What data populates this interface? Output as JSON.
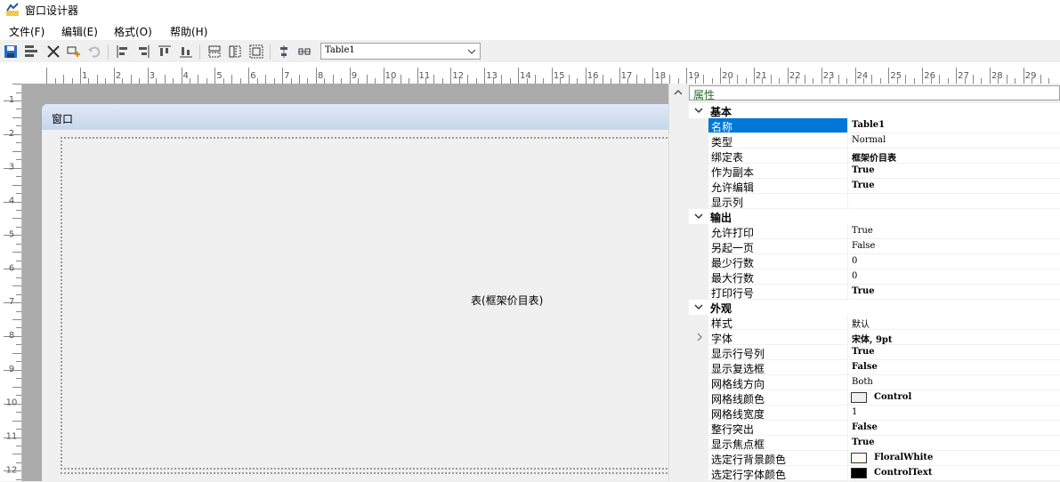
{
  "window": {
    "title": "窗口设计器"
  },
  "menu": [
    "文件(F)",
    "编辑(E)",
    "格式(O)",
    "帮助(H)"
  ],
  "toolbar": {
    "table_select": "Table1",
    "icons": [
      "save-icon",
      "save-all-icon",
      "delete-icon",
      "add-control-icon",
      "undo-icon",
      "align-left-icon",
      "align-right-icon",
      "align-top-icon",
      "align-bottom-icon",
      "same-width-icon",
      "same-height-icon",
      "same-size-icon",
      "center-vertical-icon",
      "center-horizontal-icon"
    ]
  },
  "ruler": {
    "h": [
      "1",
      "2",
      "3",
      "4",
      "5",
      "6",
      "7",
      "8",
      "9",
      "10",
      "11",
      "12",
      "13",
      "14",
      "15",
      "16",
      "17",
      "18",
      "19",
      "20",
      "21",
      "22",
      "23",
      "24",
      "25",
      "26",
      "27",
      "28",
      "29"
    ],
    "v": [
      "1",
      "2",
      "3",
      "4",
      "5",
      "6",
      "7",
      "8",
      "9",
      "10",
      "11",
      "12"
    ]
  },
  "canvas": {
    "form_title": "窗口",
    "table_label": "表(框架价目表)"
  },
  "properties": {
    "panel_title": "属性",
    "rows": [
      {
        "kind": "cat",
        "label": "基本"
      },
      {
        "kind": "prop",
        "name": "名称",
        "value": "Table1",
        "bold": true,
        "selected": true
      },
      {
        "kind": "prop",
        "name": "类型",
        "value": "Normal"
      },
      {
        "kind": "prop",
        "name": "绑定表",
        "value": "框架价目表",
        "bold": true
      },
      {
        "kind": "prop",
        "name": "作为副本",
        "value": "True",
        "bold": true
      },
      {
        "kind": "prop",
        "name": "允许编辑",
        "value": "True",
        "bold": true
      },
      {
        "kind": "prop",
        "name": "显示列",
        "value": ""
      },
      {
        "kind": "cat",
        "label": "输出"
      },
      {
        "kind": "prop",
        "name": "允许打印",
        "value": "True"
      },
      {
        "kind": "prop",
        "name": "另起一页",
        "value": "False"
      },
      {
        "kind": "prop",
        "name": "最少行数",
        "value": "0"
      },
      {
        "kind": "prop",
        "name": "最大行数",
        "value": "0"
      },
      {
        "kind": "prop",
        "name": "打印行号",
        "value": "True",
        "bold": true
      },
      {
        "kind": "cat",
        "label": "外观"
      },
      {
        "kind": "prop",
        "name": "样式",
        "value": "默认"
      },
      {
        "kind": "prop",
        "name": "字体",
        "value": "宋体, 9pt",
        "bold": true,
        "expandable": true
      },
      {
        "kind": "prop",
        "name": "显示行号列",
        "value": "True",
        "bold": true
      },
      {
        "kind": "prop",
        "name": "显示复选框",
        "value": "False",
        "bold": true
      },
      {
        "kind": "prop",
        "name": "网格线方向",
        "value": "Both"
      },
      {
        "kind": "prop",
        "name": "网格线颜色",
        "value": "Control",
        "bold": true,
        "swatch": "#f0f0f0"
      },
      {
        "kind": "prop",
        "name": "网格线宽度",
        "value": "1"
      },
      {
        "kind": "prop",
        "name": "整行突出",
        "value": "False",
        "bold": true
      },
      {
        "kind": "prop",
        "name": "显示焦点框",
        "value": "True",
        "bold": true
      },
      {
        "kind": "prop",
        "name": "选定行背景颜色",
        "value": "FloralWhite",
        "bold": true,
        "swatch": "#fffaf0"
      },
      {
        "kind": "prop",
        "name": "选定行字体颜色",
        "value": "ControlText",
        "bold": true,
        "swatch": "#000000"
      }
    ]
  },
  "colors": {
    "accent": "#0078d7",
    "canvas_bg": "#ababab",
    "form_title_bg": "#c6d6ec"
  }
}
